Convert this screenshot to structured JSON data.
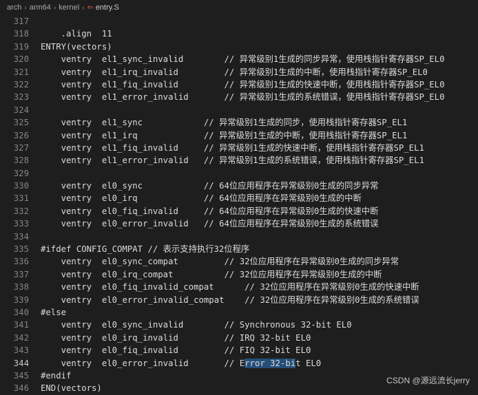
{
  "breadcrumb": [
    {
      "label": "arch"
    },
    {
      "label": "arm64"
    },
    {
      "label": "kernel"
    },
    {
      "label": "entry.S"
    }
  ],
  "lines": [
    {
      "no": "317",
      "text": ""
    },
    {
      "no": "318",
      "text": "    .align  11"
    },
    {
      "no": "319",
      "text": "ENTRY(vectors)"
    },
    {
      "no": "320",
      "text": "    ventry  el1_sync_invalid        // 异常级别1生成的同步异常，使用栈指针寄存器SP_EL0"
    },
    {
      "no": "321",
      "text": "    ventry  el1_irq_invalid         // 异常级别1生成的中断，使用栈指针寄存器SP_EL0"
    },
    {
      "no": "322",
      "text": "    ventry  el1_fiq_invalid         // 异常级别1生成的快速中断，使用栈指针寄存器SP_EL0"
    },
    {
      "no": "323",
      "text": "    ventry  el1_error_invalid       // 异常级别1生成的系统错误，使用栈指针寄存器SP_EL0"
    },
    {
      "no": "324",
      "text": ""
    },
    {
      "no": "325",
      "text": "    ventry  el1_sync            // 异常级别1生成的同步，使用栈指针寄存器SP_EL1"
    },
    {
      "no": "326",
      "text": "    ventry  el1_irq             // 异常级别1生成的中断，使用栈指针寄存器SP_EL1"
    },
    {
      "no": "327",
      "text": "    ventry  el1_fiq_invalid     // 异常级别1生成的快速中断，使用栈指针寄存器SP_EL1"
    },
    {
      "no": "328",
      "text": "    ventry  el1_error_invalid   // 异常级别1生成的系统错误，使用栈指针寄存器SP_EL1"
    },
    {
      "no": "329",
      "text": ""
    },
    {
      "no": "330",
      "text": "    ventry  el0_sync            // 64位应用程序在异常级别0生成的同步异常"
    },
    {
      "no": "331",
      "text": "    ventry  el0_irq             // 64位应用程序在异常级别0生成的中断"
    },
    {
      "no": "332",
      "text": "    ventry  el0_fiq_invalid     // 64位应用程序在异常级别0生成的快速中断"
    },
    {
      "no": "333",
      "text": "    ventry  el0_error_invalid   // 64位应用程序在异常级别0生成的系统错误"
    },
    {
      "no": "334",
      "text": ""
    },
    {
      "no": "335",
      "text": "#ifdef CONFIG_COMPAT // 表示支持执行32位程序"
    },
    {
      "no": "336",
      "text": "    ventry  el0_sync_compat         // 32位应用程序在异常级别0生成的同步异常"
    },
    {
      "no": "337",
      "text": "    ventry  el0_irq_compat          // 32位应用程序在异常级别0生成的中断"
    },
    {
      "no": "338",
      "text": "    ventry  el0_fiq_invalid_compat      // 32位应用程序在异常级别0生成的快速中断"
    },
    {
      "no": "339",
      "text": "    ventry  el0_error_invalid_compat    // 32位应用程序在异常级别0生成的系统错误"
    },
    {
      "no": "340",
      "text": "#else"
    },
    {
      "no": "341",
      "text": "    ventry  el0_sync_invalid        // Synchronous 32-bit EL0"
    },
    {
      "no": "342",
      "text": "    ventry  el0_irq_invalid         // IRQ 32-bit EL0"
    },
    {
      "no": "343",
      "text": "    ventry  el0_fiq_invalid         // FIQ 32-bit EL0"
    },
    {
      "no": "344",
      "pre": "    ventry  el0_error_invalid       // E",
      "hl": "rror 32-bi",
      "post": "t EL0"
    },
    {
      "no": "345",
      "text": "#endif"
    },
    {
      "no": "346",
      "text": "END(vectors)"
    }
  ],
  "active_line": "344",
  "watermark": "CSDN @源远流长jerry"
}
